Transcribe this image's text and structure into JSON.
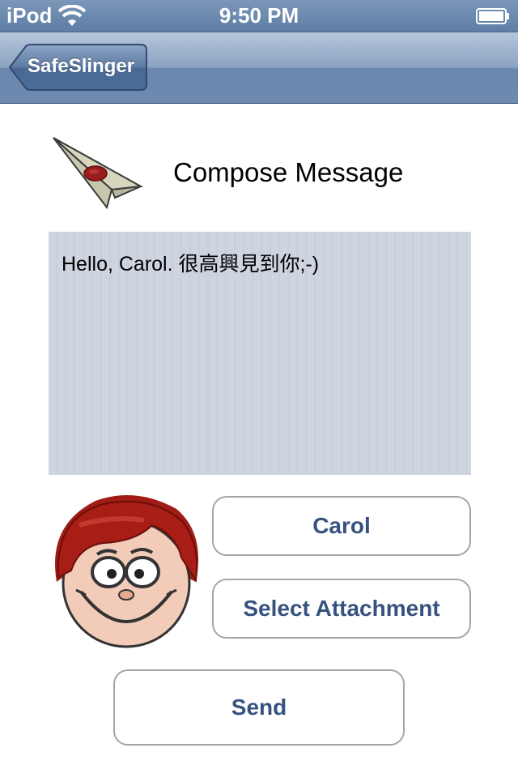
{
  "status_bar": {
    "carrier": "iPod",
    "time": "9:50 PM",
    "wifi_icon": "wifi-icon",
    "battery_icon": "battery-icon",
    "color": "#6b88ad"
  },
  "nav_bar": {
    "back_label": "SafeSlinger",
    "color": "#6f8bb1"
  },
  "header": {
    "icon": "paper-plane-icon",
    "title": "Compose Message"
  },
  "message": {
    "text": "Hello, Carol. 很高興見到你;-)",
    "background": "#cfd5e0"
  },
  "recipient": {
    "avatar": "avatar",
    "button_label": "Carol"
  },
  "attachment": {
    "button_label": "Select Attachment"
  },
  "send": {
    "button_label": "Send"
  },
  "colors": {
    "button_text": "#37527f",
    "button_border": "#a5a5a5"
  }
}
